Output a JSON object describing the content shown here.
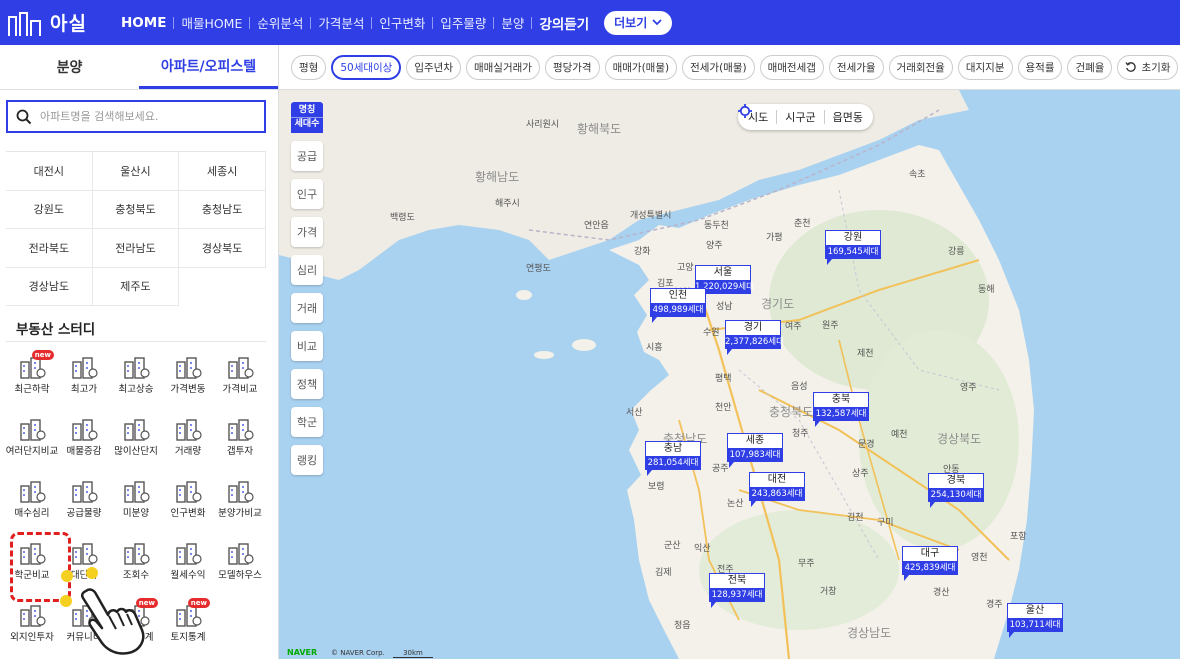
{
  "header": {
    "brand": "아실",
    "nav": [
      "HOME",
      "매물HOME",
      "순위분석",
      "가격분석",
      "인구변화",
      "입주물량",
      "분양",
      "강의듣기"
    ],
    "more_label": "더보기"
  },
  "sidebar": {
    "tabs": [
      {
        "label": "분양",
        "active": false
      },
      {
        "label": "아파트/오피스텔",
        "active": true
      }
    ],
    "search_placeholder": "아파트명을 검색해보세요.",
    "regions": [
      "대전시",
      "울산시",
      "세종시",
      "강원도",
      "충청북도",
      "충청남도",
      "전라북도",
      "전라남도",
      "경상북도",
      "경상남도",
      "제주도"
    ],
    "study_title": "부동산 스터디",
    "study_items": [
      {
        "label": "최근하락",
        "icon": "recent-drop-icon",
        "new": true
      },
      {
        "label": "최고가",
        "icon": "highest-price-icon",
        "new": false
      },
      {
        "label": "최고상승",
        "icon": "highest-rise-icon",
        "new": false
      },
      {
        "label": "가격변동",
        "icon": "price-change-icon",
        "new": false
      },
      {
        "label": "가격비교",
        "icon": "price-compare-icon",
        "new": false
      },
      {
        "label": "여러단지비교",
        "icon": "multi-complex-icon",
        "new": false
      },
      {
        "label": "매물증감",
        "icon": "listing-change-icon",
        "new": false
      },
      {
        "label": "많이산단지",
        "icon": "popular-complex-icon",
        "new": false
      },
      {
        "label": "거래량",
        "icon": "trade-volume-icon",
        "new": false
      },
      {
        "label": "갭투자",
        "icon": "gap-invest-icon",
        "new": false
      },
      {
        "label": "매수심리",
        "icon": "buy-sentiment-icon",
        "new": false
      },
      {
        "label": "공급물량",
        "icon": "supply-icon",
        "new": false
      },
      {
        "label": "미분양",
        "icon": "unsold-icon",
        "new": false
      },
      {
        "label": "인구변화",
        "icon": "population-icon",
        "new": false
      },
      {
        "label": "분양가비교",
        "icon": "presale-compare-icon",
        "new": false
      },
      {
        "label": "학군비교",
        "icon": "school-district-icon",
        "new": false
      },
      {
        "label": "대단지",
        "icon": "large-complex-icon",
        "new": false
      },
      {
        "label": "조회수",
        "icon": "views-icon",
        "new": false
      },
      {
        "label": "월세수익",
        "icon": "rent-income-icon",
        "new": false
      },
      {
        "label": "모델하우스",
        "icon": "model-house-icon",
        "new": false
      },
      {
        "label": "외지인투자",
        "icon": "outsider-invest-icon",
        "new": false
      },
      {
        "label": "커뮤니티",
        "icon": "community-icon",
        "new": false
      },
      {
        "label": "상권통계",
        "icon": "commercial-stats-icon",
        "new": true
      },
      {
        "label": "토지통계",
        "icon": "land-stats-icon",
        "new": true
      }
    ]
  },
  "filters": [
    {
      "label": "평형",
      "active": false
    },
    {
      "label": "50세대이상",
      "active": true
    },
    {
      "label": "입주년차",
      "active": false
    },
    {
      "label": "매매실거래가",
      "active": false
    },
    {
      "label": "평당가격",
      "active": false
    },
    {
      "label": "매매가(매물)",
      "active": false
    },
    {
      "label": "전세가(매물)",
      "active": false
    },
    {
      "label": "매매전세갭",
      "active": false
    },
    {
      "label": "전세가율",
      "active": false
    },
    {
      "label": "거래회전율",
      "active": false
    },
    {
      "label": "대지지분",
      "active": false
    },
    {
      "label": "용적률",
      "active": false
    },
    {
      "label": "건폐율",
      "active": false
    },
    {
      "label": "초기화",
      "active": false
    }
  ],
  "map": {
    "toggle_label_top": "명칭",
    "toggle_label_bottom": "세대수",
    "tools": [
      "공급",
      "인구",
      "가격",
      "심리",
      "거래",
      "비교",
      "정책",
      "학군",
      "랭킹"
    ],
    "levels": [
      "시도",
      "시구군",
      "읍면동"
    ],
    "markers": [
      {
        "name": "강원",
        "value": "169,545세대"
      },
      {
        "name": "서울",
        "value": "1,220,029세대"
      },
      {
        "name": "인천",
        "value": "498,989세대"
      },
      {
        "name": "경기",
        "value": "2,377,826세대"
      },
      {
        "name": "충북",
        "value": "132,587세대"
      },
      {
        "name": "세종",
        "value": "107,983세대"
      },
      {
        "name": "충남",
        "value": "281,054세대"
      },
      {
        "name": "대전",
        "value": "243,863세대"
      },
      {
        "name": "경북",
        "value": "254,130세대"
      },
      {
        "name": "대구",
        "value": "425,839세대"
      },
      {
        "name": "전북",
        "value": "128,937세대"
      },
      {
        "name": "울산",
        "value": "103,711세대"
      }
    ],
    "region_labels": [
      "황해북도",
      "황해남도",
      "경기도",
      "충청북도",
      "충청남도",
      "경상북도",
      "경상남도"
    ],
    "place_labels": [
      "사리원시",
      "해주시",
      "연안읍",
      "개성특별시",
      "백령도",
      "연평도",
      "강화",
      "동두천",
      "춘천",
      "속초",
      "강릉",
      "동해",
      "양주",
      "가평",
      "고양",
      "김포",
      "부천",
      "시흥",
      "성남",
      "수원",
      "여주",
      "원주",
      "제천",
      "평택",
      "음성",
      "서산",
      "천안",
      "청주",
      "보령",
      "공주",
      "논산",
      "상주",
      "영주",
      "예천",
      "안동",
      "문경",
      "구미",
      "김천",
      "포항",
      "군산",
      "익산",
      "김제",
      "정읍",
      "전주",
      "무주",
      "거창",
      "경산",
      "영천",
      "경주",
      "대전"
    ],
    "attribution_brand": "NAVER",
    "attribution_copy": "© NAVER Corp.",
    "scale_label": "30km"
  },
  "colors": {
    "brand": "#2f3fe5",
    "sea": "#a9d1f0",
    "land": "#f3f1e9",
    "highlight": "#e21f1f"
  }
}
